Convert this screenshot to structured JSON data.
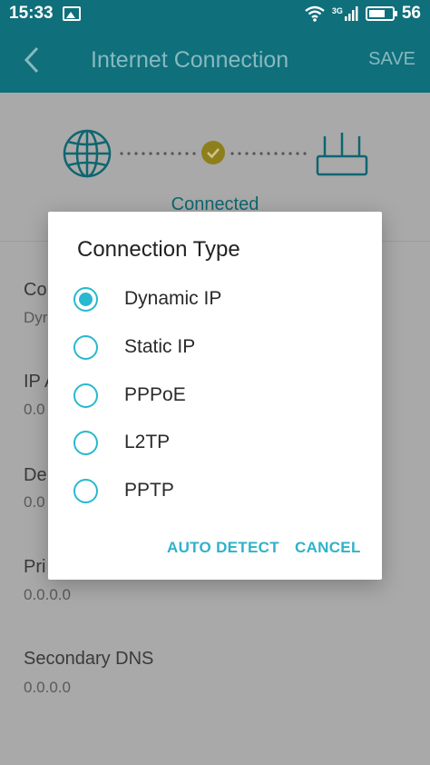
{
  "status_bar": {
    "time": "15:33",
    "network": "3G",
    "battery": "56"
  },
  "app_bar": {
    "title": "Internet Connection",
    "save_label": "SAVE"
  },
  "diagram": {
    "status": "Connected"
  },
  "background_fields": [
    {
      "label": "Co",
      "value": "Dyr"
    },
    {
      "label": "IP A",
      "value": "0.0"
    },
    {
      "label": "De",
      "value": "0.0"
    },
    {
      "label": "Pri",
      "value": "0.0.0.0"
    },
    {
      "label": "Secondary DNS",
      "value": "0.0.0.0"
    }
  ],
  "dialog": {
    "title": "Connection Type",
    "options": [
      {
        "label": "Dynamic IP",
        "selected": true
      },
      {
        "label": "Static IP",
        "selected": false
      },
      {
        "label": "PPPoE",
        "selected": false
      },
      {
        "label": "L2TP",
        "selected": false
      },
      {
        "label": "PPTP",
        "selected": false
      }
    ],
    "auto_detect_label": "AUTO DETECT",
    "cancel_label": "CANCEL"
  },
  "colors": {
    "accent": "#28b8cf",
    "app_bar": "#0f6f7b"
  }
}
